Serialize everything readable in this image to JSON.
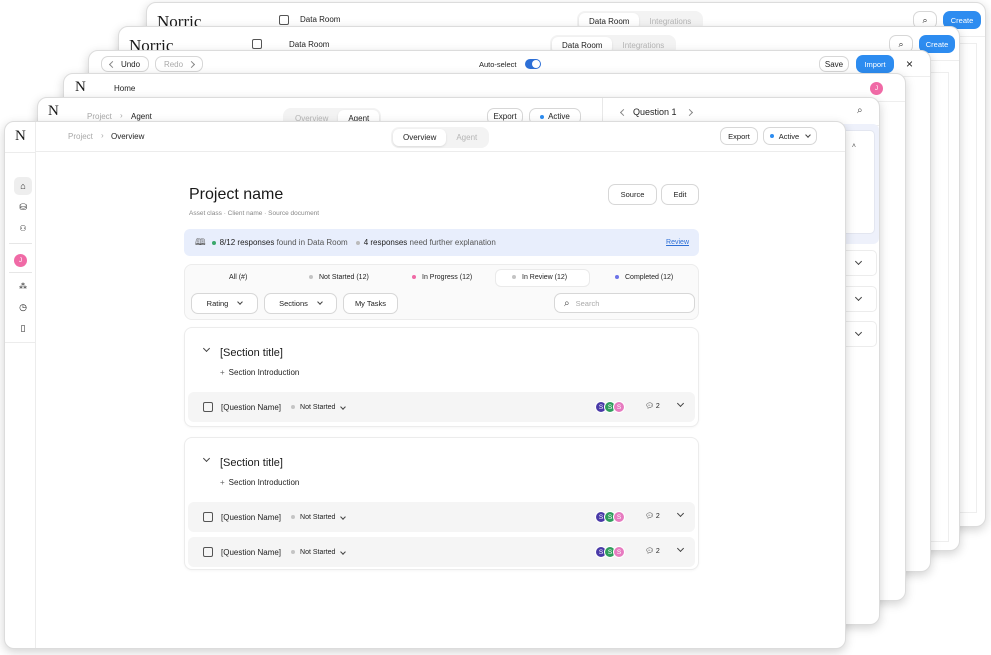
{
  "back": {
    "w1": {
      "logo": "Norric",
      "title": "Data Room",
      "tab_on": "Data Room",
      "tab_off": "Integrations",
      "create": "Create"
    },
    "w2": {
      "logo": "Norric",
      "title": "Data Room",
      "tab_on": "Data Room",
      "tab_off": "Integrations",
      "create": "Create"
    },
    "w3": {
      "undo": "Undo",
      "redo": "Redo",
      "autoselect": "Auto-select",
      "save": "Save",
      "import": "Import"
    },
    "w4": {
      "logo": "N",
      "home": "Home",
      "avatar": "J"
    },
    "w5": {
      "logo": "N",
      "crumb_project": "Project",
      "crumb_page": "Agent",
      "tab_off": "Overview",
      "tab_on": "Agent",
      "export": "Export",
      "status": "Active",
      "question": "Question 1"
    }
  },
  "front": {
    "logo": "N",
    "breadcrumb": {
      "project": "Project",
      "page": "Overview"
    },
    "tabs": {
      "overview": "Overview",
      "agent": "Agent"
    },
    "export": "Export",
    "status": "Active",
    "sidebar": {
      "avatar": "J"
    },
    "project": {
      "title": "Project name",
      "meta": [
        "Asset class",
        "Client name",
        "Source document"
      ],
      "source_btn": "Source",
      "edit_btn": "Edit"
    },
    "banner": {
      "count": "8/12 responses",
      "text1": "found in Data Room",
      "count2": "4 responses",
      "text2": "need further explanation",
      "link": "Review"
    },
    "filters": [
      {
        "label": "All (#)",
        "color": ""
      },
      {
        "label": "Not Started (12)",
        "color": "#c4c4c4"
      },
      {
        "label": "In Progress (12)",
        "color": "#f06aa6"
      },
      {
        "label": "In Review (12)",
        "color": "#c4c4c4"
      },
      {
        "label": "Completed (12)",
        "color": "#6c73e8"
      }
    ],
    "toolbar": {
      "rating": "Rating",
      "sections": "Sections",
      "mytasks": "My Tasks",
      "search_placeholder": "Search"
    },
    "sections": [
      {
        "title": "[Section title]",
        "intro": "Section Introduction",
        "questions": [
          {
            "name": "[Question Name]",
            "status": "Not Started",
            "comments": "2",
            "avatars": [
              "S",
              "S",
              "S"
            ]
          }
        ]
      },
      {
        "title": "[Section title]",
        "intro": "Section Introduction",
        "questions": [
          {
            "name": "[Question Name]",
            "status": "Not Started",
            "comments": "2",
            "avatars": [
              "S",
              "S",
              "S"
            ]
          },
          {
            "name": "[Question Name]",
            "status": "Not Started",
            "comments": "2",
            "avatars": [
              "S",
              "S",
              "S"
            ]
          }
        ]
      }
    ],
    "colors": {
      "accent": "#2d8cf0",
      "avatar_pink": "#f06aa6",
      "av1": "#4a3aa8",
      "av2": "#2f9e5b",
      "av3": "#e77bc0",
      "banner_bg": "#e8eefc"
    }
  }
}
